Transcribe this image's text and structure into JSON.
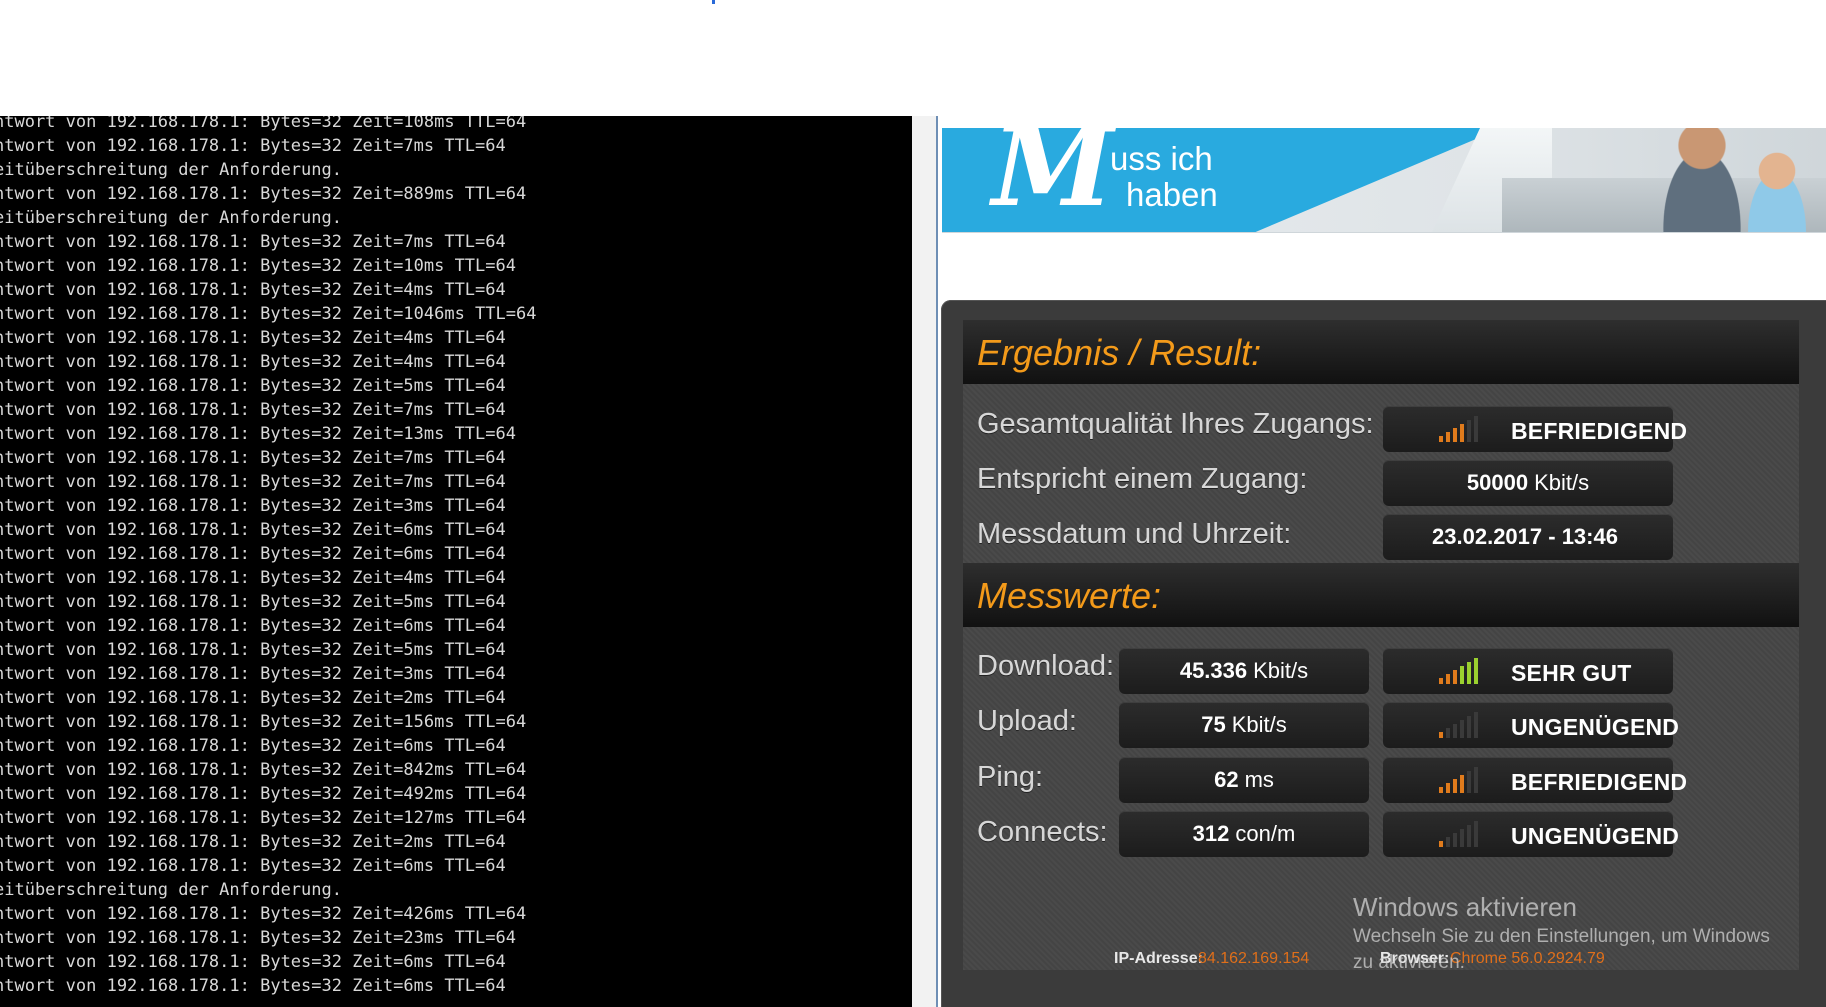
{
  "terminal": {
    "lines": [
      "ntwort von 192.168.178.1: Bytes=32 Zeit=108ms TTL=64",
      "ntwort von 192.168.178.1: Bytes=32 Zeit=7ms TTL=64",
      "eitüberschreitung der Anforderung.",
      "ntwort von 192.168.178.1: Bytes=32 Zeit=889ms TTL=64",
      "eitüberschreitung der Anforderung.",
      "ntwort von 192.168.178.1: Bytes=32 Zeit=7ms TTL=64",
      "ntwort von 192.168.178.1: Bytes=32 Zeit=10ms TTL=64",
      "ntwort von 192.168.178.1: Bytes=32 Zeit=4ms TTL=64",
      "ntwort von 192.168.178.1: Bytes=32 Zeit=1046ms TTL=64",
      "ntwort von 192.168.178.1: Bytes=32 Zeit=4ms TTL=64",
      "ntwort von 192.168.178.1: Bytes=32 Zeit=4ms TTL=64",
      "ntwort von 192.168.178.1: Bytes=32 Zeit=5ms TTL=64",
      "ntwort von 192.168.178.1: Bytes=32 Zeit=7ms TTL=64",
      "ntwort von 192.168.178.1: Bytes=32 Zeit=13ms TTL=64",
      "ntwort von 192.168.178.1: Bytes=32 Zeit=7ms TTL=64",
      "ntwort von 192.168.178.1: Bytes=32 Zeit=7ms TTL=64",
      "ntwort von 192.168.178.1: Bytes=32 Zeit=3ms TTL=64",
      "ntwort von 192.168.178.1: Bytes=32 Zeit=6ms TTL=64",
      "ntwort von 192.168.178.1: Bytes=32 Zeit=6ms TTL=64",
      "ntwort von 192.168.178.1: Bytes=32 Zeit=4ms TTL=64",
      "ntwort von 192.168.178.1: Bytes=32 Zeit=5ms TTL=64",
      "ntwort von 192.168.178.1: Bytes=32 Zeit=6ms TTL=64",
      "ntwort von 192.168.178.1: Bytes=32 Zeit=5ms TTL=64",
      "ntwort von 192.168.178.1: Bytes=32 Zeit=3ms TTL=64",
      "ntwort von 192.168.178.1: Bytes=32 Zeit=2ms TTL=64",
      "ntwort von 192.168.178.1: Bytes=32 Zeit=156ms TTL=64",
      "ntwort von 192.168.178.1: Bytes=32 Zeit=6ms TTL=64",
      "ntwort von 192.168.178.1: Bytes=32 Zeit=842ms TTL=64",
      "ntwort von 192.168.178.1: Bytes=32 Zeit=492ms TTL=64",
      "ntwort von 192.168.178.1: Bytes=32 Zeit=127ms TTL=64",
      "ntwort von 192.168.178.1: Bytes=32 Zeit=2ms TTL=64",
      "ntwort von 192.168.178.1: Bytes=32 Zeit=6ms TTL=64",
      "eitüberschreitung der Anforderung.",
      "ntwort von 192.168.178.1: Bytes=32 Zeit=426ms TTL=64",
      "ntwort von 192.168.178.1: Bytes=32 Zeit=23ms TTL=64",
      "ntwort von 192.168.178.1: Bytes=32 Zeit=6ms TTL=64",
      "ntwort von 192.168.178.1: Bytes=32 Zeit=6ms TTL=64"
    ]
  },
  "banner": {
    "logo_letter": "M",
    "line1": "uss ich",
    "line2": "haben"
  },
  "result": {
    "heading": "Ergebnis / Result:",
    "rows": [
      {
        "label": "Gesamtqualität Ihres Zugangs:",
        "rating": "BEFRIEDIGEND",
        "level": 4
      },
      {
        "label": "Entspricht einem Zugang:",
        "value": "50000",
        "unit": "Kbit/s"
      },
      {
        "label": "Messdatum und Uhrzeit:",
        "value": "23.02.2017 - 13:46"
      }
    ]
  },
  "measurements": {
    "heading": "Messwerte:",
    "rows": [
      {
        "label": "Download:",
        "value": "45.336",
        "unit": "Kbit/s",
        "rating": "SEHR GUT",
        "level": 6
      },
      {
        "label": "Upload:",
        "value": "75",
        "unit": "Kbit/s",
        "rating": "UNGENÜGEND",
        "level": 1
      },
      {
        "label": "Ping:",
        "value": "62",
        "unit": "ms",
        "rating": "BEFRIEDIGEND",
        "level": 4
      },
      {
        "label": "Connects:",
        "value": "312",
        "unit": "con/m",
        "rating": "UNGENÜGEND",
        "level": 1
      }
    ]
  },
  "footer": {
    "ip_label": "IP-Adresse:",
    "ip_value": "84.162.169.154",
    "browser_label": "Browser:",
    "browser_value": "Chrome 56.0.2924.79"
  },
  "watermark": {
    "title": "Windows aktivieren",
    "line1": "Wechseln Sie zu den Einstellungen, um Windows",
    "line2": "zu aktivieren."
  },
  "colors": {
    "accent": "#f39a1a",
    "bar_inactive": "#3a3a3a",
    "bar_orange": "#e07b1c",
    "bar_green": "#9bd12f"
  }
}
